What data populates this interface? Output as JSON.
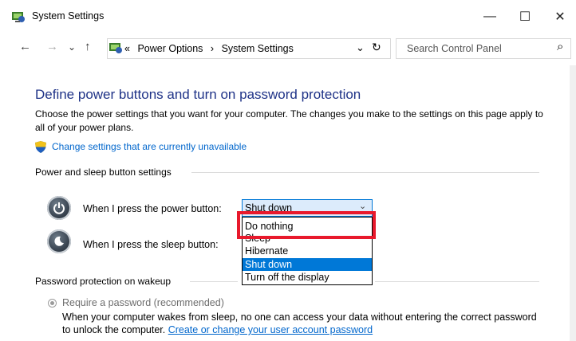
{
  "window": {
    "title": "System Settings",
    "minimize": "—",
    "maximize": "☐",
    "close": "✕"
  },
  "nav": {
    "back": "←",
    "forward": "→",
    "recent": "⌄",
    "up": "↑",
    "breadcrumb_prefix": "«",
    "breadcrumbs": [
      "Power Options",
      "System Settings"
    ],
    "separator": "›",
    "dropdown": "⌄",
    "refresh": "↻",
    "search_placeholder": "Search Control Panel",
    "search_icon": "⌕"
  },
  "main": {
    "heading": "Define power buttons and turn on password protection",
    "description": "Choose the power settings that you want for your computer. The changes you make to the settings on this page apply to all of your power plans.",
    "change_link": "Change settings that are currently unavailable",
    "power_section": {
      "label": "Power and sleep button settings",
      "power_row_label": "When I press the power button:",
      "power_value": "Shut down",
      "sleep_row_label": "When I press the sleep button:"
    },
    "dropdown_options": [
      {
        "label": "Do nothing",
        "selected": false
      },
      {
        "label": "Sleep",
        "selected": false
      },
      {
        "label": "Hibernate",
        "selected": false
      },
      {
        "label": "Shut down",
        "selected": true
      },
      {
        "label": "Turn off the display",
        "selected": false
      }
    ],
    "password_section": {
      "label": "Password protection on wakeup",
      "radio_label": "Require a password (recommended)",
      "wake_text": "When your computer wakes from sleep, no one can access your data without entering the correct password to unlock the computer. ",
      "wake_link": "Create or change your user account password"
    }
  },
  "colors": {
    "heading": "#1e3287",
    "link": "#0066cc",
    "selection": "#0078d7",
    "highlight": "#e8192c"
  }
}
